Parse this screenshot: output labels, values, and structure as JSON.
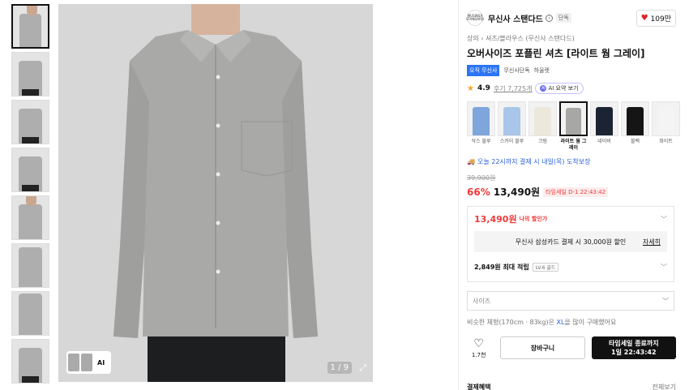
{
  "gallery": {
    "thumbnail_count": 8,
    "page_indicator": "1 / 9",
    "mini_strip_label": "AI"
  },
  "brand": {
    "logo_text": "MUSINSA STANDARD",
    "name": "무신사 스탠다드",
    "tag": "단독",
    "likes": "109만"
  },
  "breadcrumb": "상의 › 셔츠/블라우스 (무신사 스탠다드)",
  "title": "오버사이즈 포플린 셔츠 [라이트 웜 그레이]",
  "tags": [
    "오직 무신사",
    "무신사단독",
    "하울렛"
  ],
  "rating": {
    "score": "4.9",
    "reviews": "후기 7,725개",
    "ai_summary": "AI 요약 보기"
  },
  "swatches": [
    {
      "label": "삭스 블루",
      "color": "#7fa6dc",
      "active": false
    },
    {
      "label": "스카이 블루",
      "color": "#a9c6ea",
      "active": false
    },
    {
      "label": "크림",
      "color": "#ece8dc",
      "active": false
    },
    {
      "label": "라이트 웜 그레이",
      "color": "#a7a7a4",
      "active": true
    },
    {
      "label": "네이비",
      "color": "#1c2433",
      "active": false
    },
    {
      "label": "블랙",
      "color": "#151515",
      "active": false
    },
    {
      "label": "화이트",
      "color": "#f4f4f4",
      "active": false
    }
  ],
  "delivery": "오늘 22시까지 결제 시 내일(목) 도착보장",
  "pricing": {
    "original": "39,900원",
    "discount": "66%",
    "price": "13,490원",
    "timesale": "타임세일 D-1 22:43:42",
    "my_price": "13,490원",
    "my_price_label": "나의 할인가",
    "card_offer": "무신사 삼성카드 결제 시 30,000원 할인",
    "card_detail": "자세히",
    "points": "2,849원 최대 적립",
    "level": "LV.6 골드"
  },
  "size": {
    "placeholder": "사이즈",
    "note_prefix": "비슷한 체형(170cm · 83kg)은 ",
    "note_size": "XL",
    "note_suffix": "을 많이 구매했어요"
  },
  "actions": {
    "like_count": "1.7천",
    "cart": "장바구니",
    "buy_line1": "타임세일 종료까지",
    "buy_line2": "1일 22:43:42"
  },
  "bottom": {
    "left": "결제혜택",
    "right": "전체보기"
  },
  "colors": {
    "accent_red": "#f03a3a",
    "accent_blue": "#2b75f5",
    "link_blue": "#2b5fd9"
  }
}
